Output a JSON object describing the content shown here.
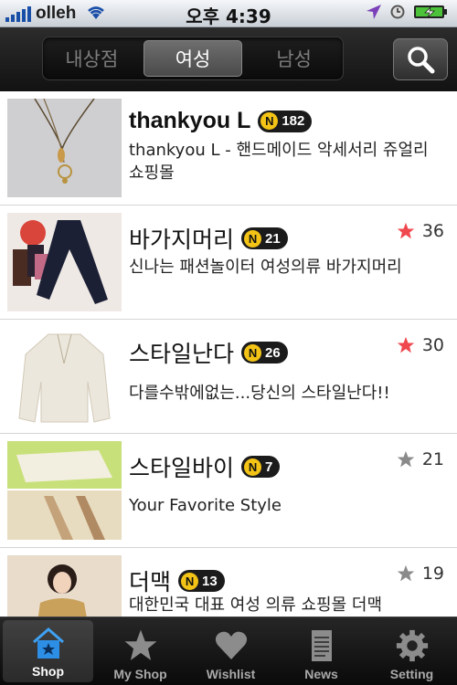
{
  "status_bar": {
    "carrier": "olleh",
    "time": "오후 4:39"
  },
  "segments": [
    "내상점",
    "여성",
    "남성"
  ],
  "active_segment": 1,
  "shops": [
    {
      "name": "thankyou L",
      "badge": "N",
      "count": "182",
      "description": "thankyou L - 핸드메이드 악세서리 쥬얼리 쇼핑몰",
      "stars": null
    },
    {
      "name": "바가지머리",
      "badge": "N",
      "count": "21",
      "description": "신나는 패션놀이터 여성의류 바가지머리",
      "stars": "36",
      "star_color": "#f0484f"
    },
    {
      "name": "스타일난다",
      "badge": "N",
      "count": "26",
      "description": "다를수밖에없는...당신의 스타일난다!!",
      "stars": "30",
      "star_color": "#f0484f"
    },
    {
      "name": "스타일바이",
      "badge": "N",
      "count": "7",
      "description": "Your Favorite Style",
      "stars": "21",
      "star_color": "#8a8a8a"
    },
    {
      "name": "더맥",
      "badge": "N",
      "count": "13",
      "description": "대한민국 대표 여성 의류 쇼핑몰 더맥",
      "stars": "19",
      "star_color": "#8a8a8a"
    }
  ],
  "tabs": [
    {
      "label": "Shop",
      "icon": "house-icon"
    },
    {
      "label": "My Shop",
      "icon": "star-icon"
    },
    {
      "label": "Wishlist",
      "icon": "heart-icon"
    },
    {
      "label": "News",
      "icon": "document-icon"
    },
    {
      "label": "Setting",
      "icon": "gear-icon"
    }
  ],
  "active_tab": 0
}
